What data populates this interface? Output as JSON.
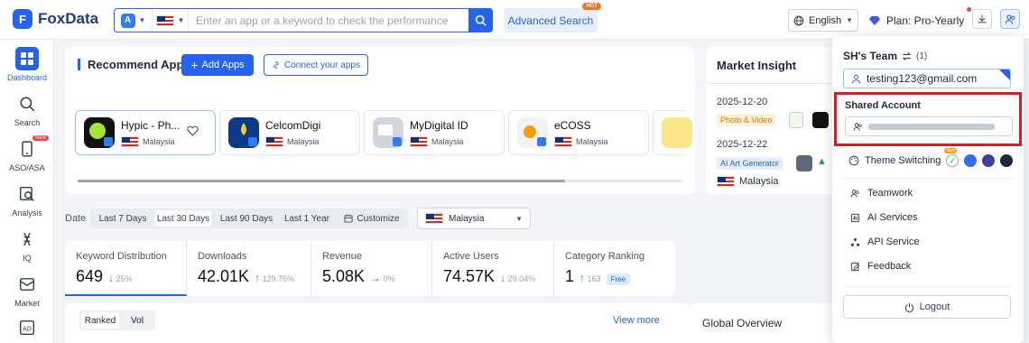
{
  "brand": {
    "name": "FoxData"
  },
  "search": {
    "placeholder": "Enter an app or a keyword to check the performance"
  },
  "header": {
    "advanced_search": "Advanced Search",
    "hot_badge": "HOT",
    "language": "English",
    "plan": "Plan: Pro-Yearly"
  },
  "sidebar": {
    "items": [
      {
        "label": "Dashboard",
        "icon": "dashboard-icon"
      },
      {
        "label": "Search",
        "icon": "search-icon"
      },
      {
        "label": "ASO/ASA",
        "icon": "phone-icon",
        "badge": "New"
      },
      {
        "label": "Analysis",
        "icon": "analysis-icon"
      },
      {
        "label": "IQ",
        "icon": "iq-icon"
      },
      {
        "label": "Market",
        "icon": "market-icon"
      },
      {
        "label": "",
        "icon": "ad-icon"
      }
    ]
  },
  "recommend": {
    "title": "Recommend Apps",
    "add_apps": "Add Apps",
    "connect": "Connect your apps",
    "apps": [
      {
        "name": "Hypic - Ph...",
        "country": "Malaysia",
        "color": "#111111"
      },
      {
        "name": "CelcomDigi",
        "country": "Malaysia",
        "color": "#0b3a8c"
      },
      {
        "name": "MyDigital ID",
        "country": "Malaysia",
        "color": "#cfd6e0"
      },
      {
        "name": "eCOSS",
        "country": "Malaysia",
        "color": "#f3f3f3"
      }
    ]
  },
  "market_insight": {
    "title": "Market Insight",
    "entries": [
      {
        "date": "2025-12-20",
        "tag": "Photo & Video"
      },
      {
        "date": "2025-12-22",
        "tag": "AI Art Generator"
      }
    ],
    "country": "Malaysia"
  },
  "filters": {
    "date_label": "Date",
    "ranges": [
      "Last 7 Days",
      "Last 30 Days",
      "Last 90 Days",
      "Last 1 Year",
      "Customize"
    ],
    "active_range": "Last 30 Days",
    "country": "Malaysia"
  },
  "metrics": [
    {
      "label": "Keyword Distribution",
      "value": "649",
      "arrow": "↓",
      "change": "25%",
      "color": "#ef4444"
    },
    {
      "label": "Downloads",
      "value": "42.01K",
      "arrow": "↑",
      "change": "129.76%",
      "color": "#16a34a"
    },
    {
      "label": "Revenue",
      "value": "5.08K",
      "arrow": "→",
      "change": "0%",
      "color": "#4b5563"
    },
    {
      "label": "Active Users",
      "value": "74.57K",
      "arrow": "↓",
      "change": "29.04%",
      "color": "#ef4444"
    },
    {
      "label": "Category Ranking",
      "value": "1",
      "arrow": "↑",
      "change": "163",
      "color": "#16a34a",
      "badge": "Free"
    }
  ],
  "bottom": {
    "seg": [
      "Ranked",
      "Vol"
    ],
    "view_more": "View more",
    "global_title": "Global Overview"
  },
  "panel": {
    "team": "SH's Team",
    "team_count": "(1)",
    "email": "testing123@gmail.com",
    "shared_title": "Shared Account",
    "theme_label": "Theme Switching",
    "theme_new": "New",
    "theme_colors": [
      "#2f6fe8",
      "#3b3f9e",
      "#1f2937"
    ],
    "menu": [
      {
        "label": "Teamwork",
        "icon": "teamwork-icon"
      },
      {
        "label": "AI Services",
        "icon": "ai-services-icon"
      },
      {
        "label": "API Service",
        "icon": "api-icon"
      },
      {
        "label": "Feedback",
        "icon": "feedback-icon"
      }
    ],
    "logout": "Logout"
  },
  "colors": {
    "accent": "#2563eb",
    "highlight_border": "#d81e1e"
  }
}
